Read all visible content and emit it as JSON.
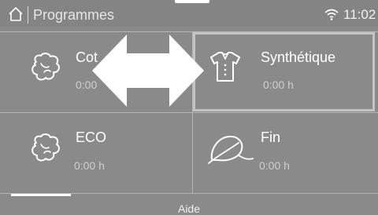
{
  "header": {
    "title": "Programmes",
    "time": "11:02",
    "home_icon": "home-icon",
    "wifi_icon": "wifi-icon"
  },
  "programs": [
    {
      "name": "Cot",
      "duration": "0:00",
      "icon": "cotton-boll-icon"
    },
    {
      "name": "Synthétique",
      "duration": "0:00 h",
      "icon": "shirt-icon",
      "selected": true
    },
    {
      "name": "ECO",
      "duration": "0:00 h",
      "icon": "cotton-boll-icon"
    },
    {
      "name": "Fin",
      "duration": "0:00 h",
      "icon": "feather-icon"
    }
  ],
  "overlay": {
    "icon": "swipe-arrow-icon"
  },
  "footer": {
    "help_label": "Aide"
  },
  "colors": {
    "background": "#8a8a8a",
    "text": "#ffffff",
    "muted_text": "#cfcfcf",
    "divider": "#b5b5b5",
    "selection_border": "#c4c4c4"
  }
}
